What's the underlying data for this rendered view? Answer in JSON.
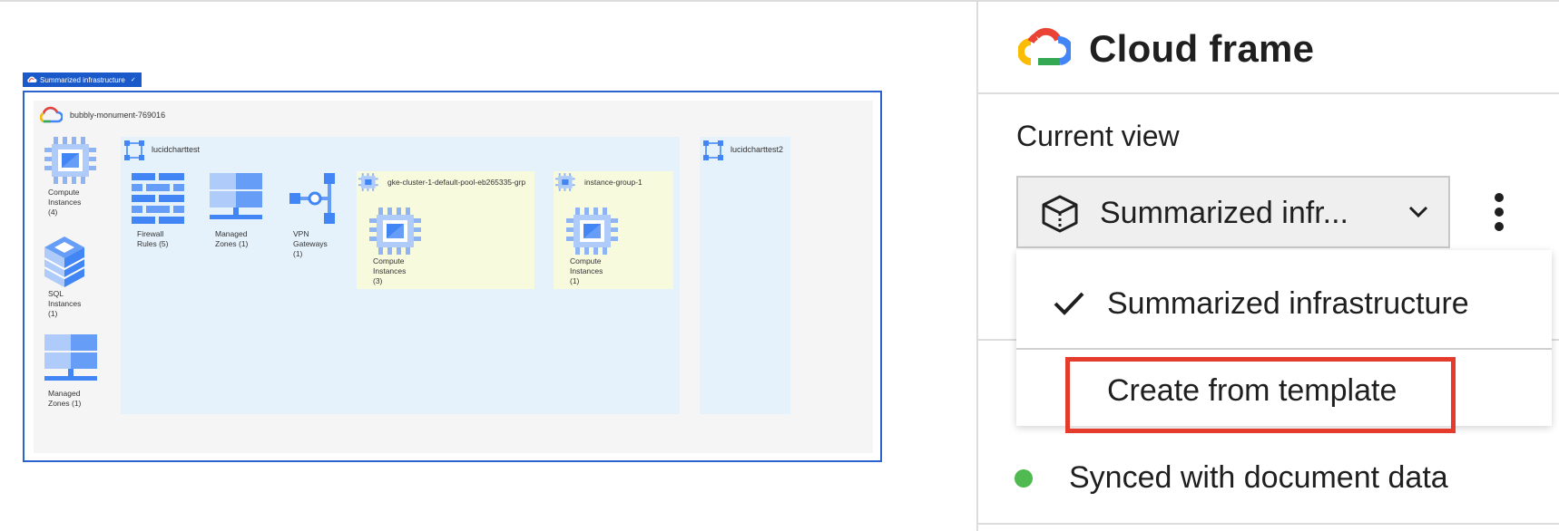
{
  "canvas": {
    "frame_tab_label": "Summarized infrastructure",
    "project": {
      "name": "bubbly-monument-769016",
      "resources": [
        {
          "label_lines": [
            "Compute",
            "Instances",
            "(4)"
          ]
        },
        {
          "label_lines": [
            "SQL",
            "Instances",
            "(1)"
          ]
        },
        {
          "label_lines": [
            "Managed",
            "Zones (1)"
          ]
        }
      ]
    },
    "vpc1": {
      "name": "lucidcharttest",
      "resources": [
        {
          "label_lines": [
            "Firewall",
            "Rules (5)"
          ]
        },
        {
          "label_lines": [
            "Managed",
            "Zones (1)"
          ]
        },
        {
          "label_lines": [
            "VPN",
            "Gateways",
            "(1)"
          ]
        }
      ],
      "groups": [
        {
          "name": "gke-cluster-1-default-pool-eb265335-grp",
          "label_lines": [
            "Compute",
            "Instances",
            "(3)"
          ]
        },
        {
          "name": "instance-group-1",
          "label_lines": [
            "Compute",
            "Instances",
            "(1)"
          ]
        }
      ]
    },
    "vpc2": {
      "name": "lucidcharttest2"
    }
  },
  "panel": {
    "title": "Cloud frame",
    "current_view_label": "Current view",
    "selected_view": "Summarized infr...",
    "dropdown": {
      "options": [
        {
          "label": "Summarized infrastructure",
          "checked": true
        },
        {
          "label": "Create from template",
          "checked": false
        }
      ]
    },
    "sync_status": "Synced with document data"
  },
  "colors": {
    "accent_blue": "#1a59c9",
    "highlight_red": "#e53b2c",
    "sync_green": "#4fba4f",
    "vpc_bg": "#e6f2fb",
    "group_bg": "#f8fade"
  }
}
